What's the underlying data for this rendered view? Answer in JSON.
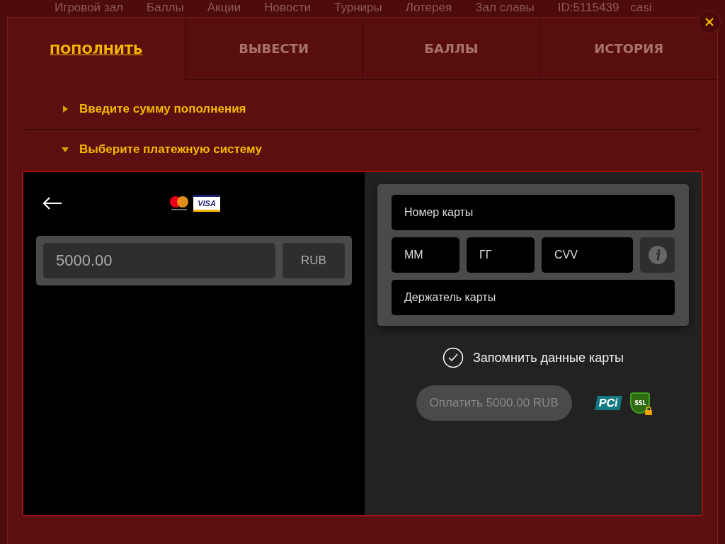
{
  "top_nav": {
    "items": [
      "Игровой зал",
      "Баллы",
      "Акции",
      "Новости",
      "Турниры",
      "Лотерея",
      "Зал славы"
    ],
    "user_id": "ID:5115439",
    "cut_label": "casi"
  },
  "tabs": [
    {
      "label": "ПОПОЛНИТЬ",
      "selected": true
    },
    {
      "label": "ВЫВЕСТИ",
      "selected": false
    },
    {
      "label": "БАЛЛЫ",
      "selected": false
    },
    {
      "label": "ИСТОРИЯ",
      "selected": false
    }
  ],
  "sections": [
    {
      "title": "Введите сумму пополнения",
      "expanded": false
    },
    {
      "title": "Выберите платежную систему",
      "expanded": true
    }
  ],
  "payment": {
    "logos": {
      "visa": "VISA",
      "pci": "PCi",
      "ssl": "SSL"
    },
    "amount": {
      "value": "5000.00",
      "currency": "RUB"
    },
    "card_fields": {
      "number": {
        "placeholder": "Номер карты"
      },
      "month": {
        "placeholder": "ММ"
      },
      "year": {
        "placeholder": "ГГ"
      },
      "cvv": {
        "placeholder": "CVV"
      },
      "holder": {
        "placeholder": "Держатель карты"
      }
    },
    "remember": {
      "label": "Запомнить данные карты",
      "checked": true
    },
    "pay_button": {
      "label": "Оплатить 5000.00 RUB",
      "disabled": true
    }
  }
}
